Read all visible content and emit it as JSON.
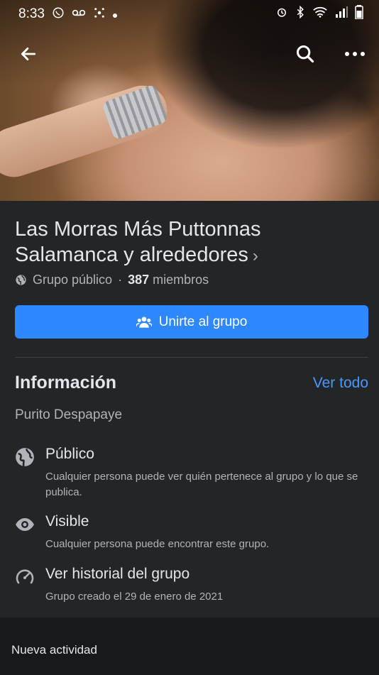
{
  "status": {
    "time": "8:33",
    "left_icons": [
      "whatsapp-icon",
      "voicemail-icon",
      "app-icon",
      "dot-icon"
    ],
    "right_icons": [
      "alarm-icon",
      "bluetooth-icon",
      "wifi-icon",
      "signal-icon",
      "battery-icon"
    ]
  },
  "topbar": {
    "back_icon": "arrow-left-icon",
    "search_icon": "search-icon",
    "more_icon": "more-horizontal-icon"
  },
  "group": {
    "title": "Las Morras Más Puttonnas Salamanca y alrededores",
    "title_chevron": "›",
    "privacy": "Grupo público",
    "separator": "·",
    "member_count": "387",
    "members_label": "miembros",
    "join_label": "Unirte al grupo"
  },
  "info": {
    "title": "Información",
    "see_all": "Ver todo",
    "description": "Purito Despapaye",
    "items": [
      {
        "icon": "globe-icon",
        "title": "Público",
        "subtitle": "Cualquier persona puede ver quién pertenece al grupo y lo que se publica."
      },
      {
        "icon": "eye-icon",
        "title": "Visible",
        "subtitle": "Cualquier persona puede encontrar este grupo."
      },
      {
        "icon": "history-icon",
        "title": "Ver historial del grupo",
        "subtitle": "Grupo creado el 29 de enero de 2021"
      }
    ]
  },
  "bottom": {
    "title": "Nueva actividad"
  },
  "colors": {
    "accent": "#2d88ff",
    "link": "#4599ff",
    "panel": "#242526",
    "background": "#18191a"
  }
}
